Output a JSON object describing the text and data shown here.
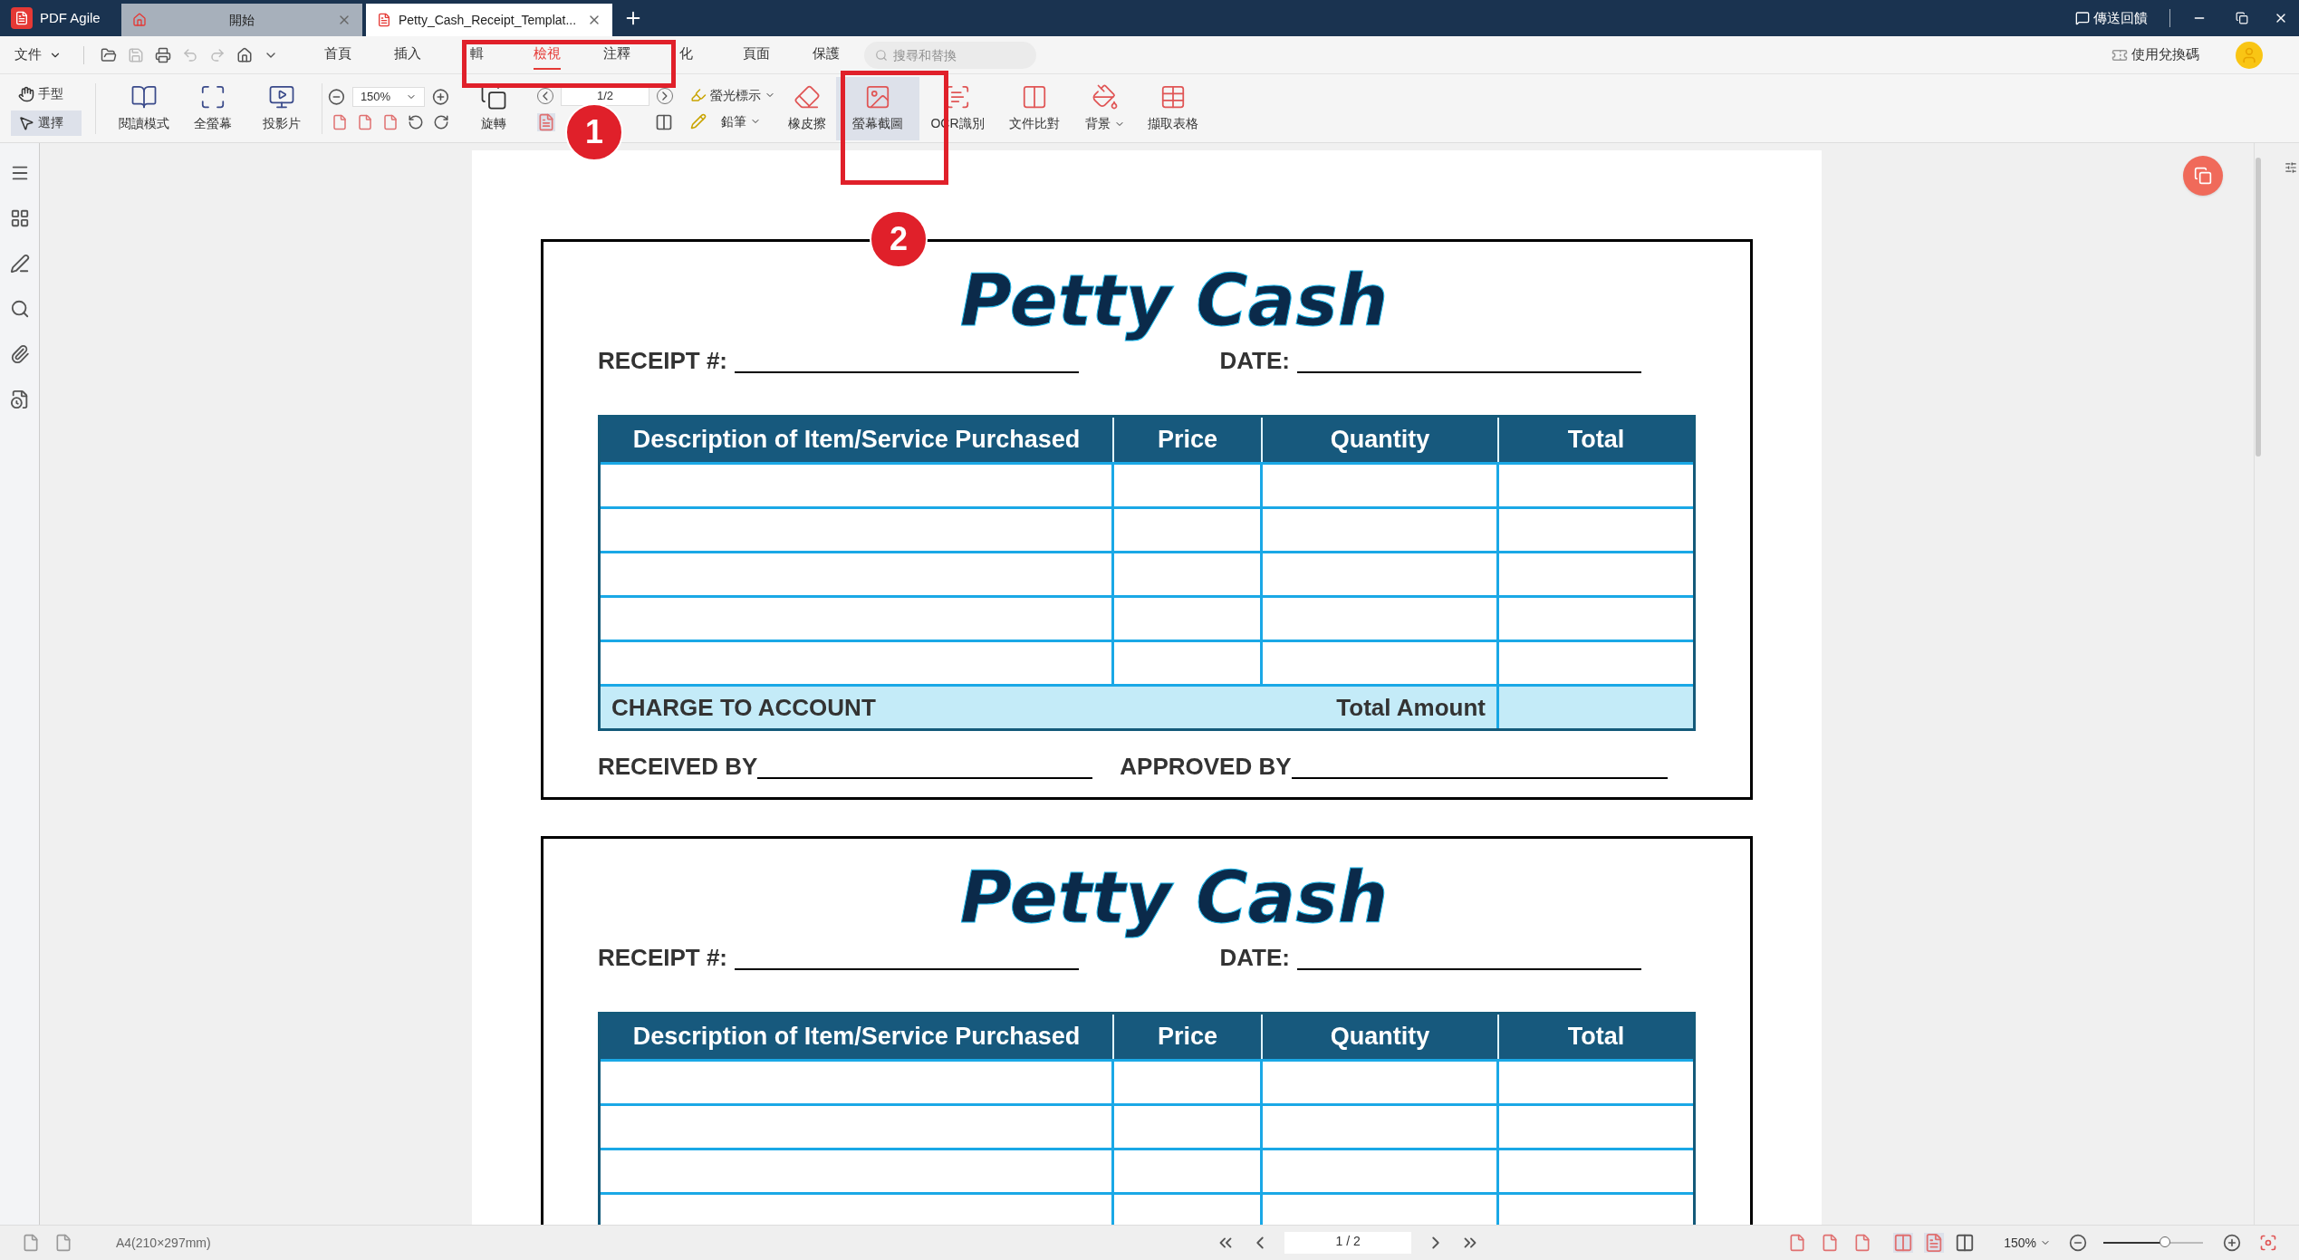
{
  "app": {
    "name": "PDF Agile",
    "feedback": "傳送回饋",
    "redeem": "使用兌換碼"
  },
  "tabs": [
    {
      "label": "開始",
      "selected": false
    },
    {
      "label": "Petty_Cash_Receipt_Templat...",
      "selected": true
    }
  ],
  "menu": {
    "file": "文件",
    "items": [
      {
        "label": "首頁",
        "selected": false
      },
      {
        "label": "插入",
        "selected": false
      },
      {
        "label": "輯",
        "selected": false
      },
      {
        "label": "檢視",
        "selected": true
      },
      {
        "label": "注釋",
        "selected": false
      },
      {
        "label": "化",
        "selected": false
      },
      {
        "label": "頁面",
        "selected": false
      },
      {
        "label": "保護",
        "selected": false
      }
    ],
    "search_placeholder": "搜尋和替換"
  },
  "toolbar": {
    "hand": {
      "label": "手型",
      "selected": false
    },
    "select": {
      "label": "選擇",
      "selected": true
    },
    "views": [
      {
        "kind": "read",
        "label": "閱讀模式"
      },
      {
        "kind": "full",
        "label": "全螢幕"
      },
      {
        "kind": "slide",
        "label": "投影片"
      }
    ],
    "zoom": "150%",
    "rotate": "旋轉",
    "page": "1/2",
    "highlight": "螢光標示",
    "pencil": "鉛筆",
    "tools": [
      {
        "kind": "eraser",
        "label": "橡皮擦",
        "selected": false,
        "dropdown": false
      },
      {
        "kind": "screenshot",
        "label": "螢幕截圖",
        "selected": true,
        "dropdown": false
      },
      {
        "kind": "ocr",
        "label": "OCR識別",
        "selected": false,
        "dropdown": false
      },
      {
        "kind": "compare",
        "label": "文件比對",
        "selected": false,
        "dropdown": false
      },
      {
        "kind": "background",
        "label": "背景",
        "selected": false,
        "dropdown": true
      },
      {
        "kind": "table",
        "label": "擷取表格",
        "selected": false,
        "dropdown": false
      }
    ]
  },
  "receipts": [
    {
      "title": "Petty Cash",
      "receipt_label": "RECEIPT #:",
      "date_label": "DATE:",
      "columns": [
        "Description of Item/Service Purchased",
        "Price",
        "Quantity",
        "Total"
      ],
      "charge": "CHARGE TO ACCOUNT",
      "total_amount": "Total Amount",
      "received": "RECEIVED BY",
      "approved": "APPROVED BY"
    },
    {
      "title": "Petty Cash",
      "receipt_label": "RECEIPT #:",
      "date_label": "DATE:",
      "columns": [
        "Description of Item/Service Purchased",
        "Price",
        "Quantity",
        "Total"
      ]
    }
  ],
  "status": {
    "paper": "A4(210×297mm)",
    "page": "1 / 2",
    "zoom": "150%",
    "zoom_slider": {
      "level": 0.62
    }
  },
  "annotations": [
    {
      "number": "1"
    },
    {
      "number": "2"
    }
  ]
}
